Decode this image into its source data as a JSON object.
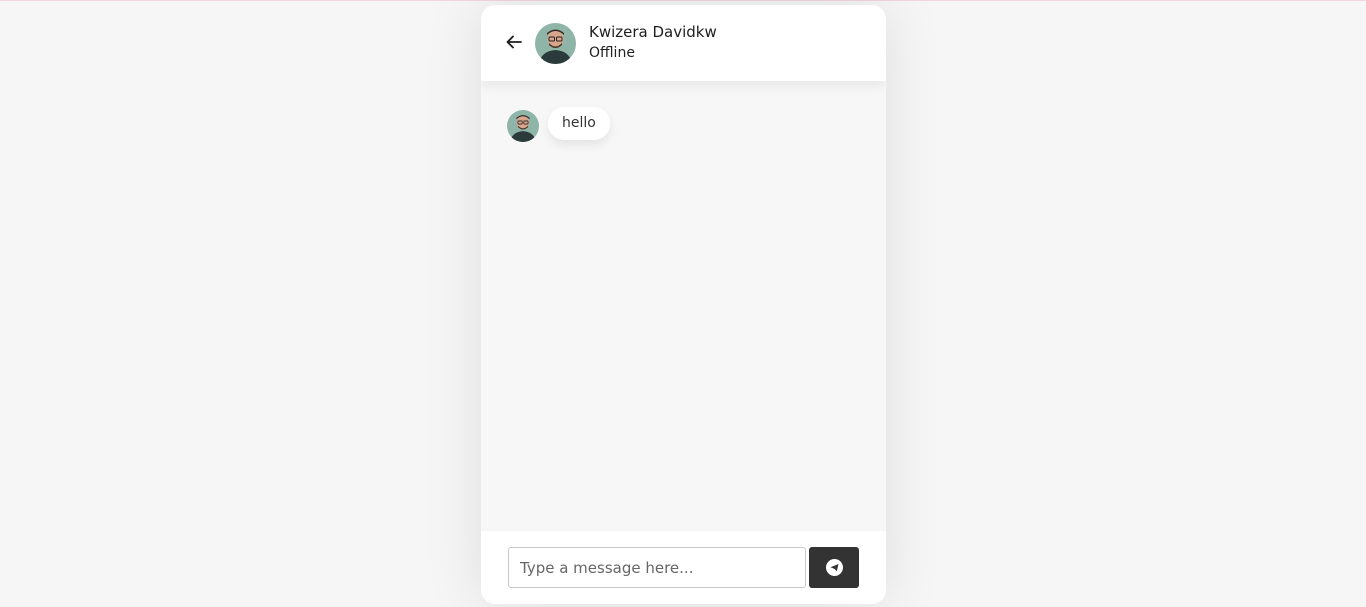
{
  "contact": {
    "name": "Kwizera Davidkw",
    "status": "Offline"
  },
  "messages": [
    {
      "text": "hello",
      "from": "contact"
    }
  ],
  "composer": {
    "placeholder": "Type a message here...",
    "value": ""
  },
  "icons": {
    "back": "arrow-left-icon",
    "send": "telegram-send-icon"
  },
  "colors": {
    "page_background": "#f6f6f6",
    "panel_background": "#ffffff",
    "send_button": "#333333"
  }
}
